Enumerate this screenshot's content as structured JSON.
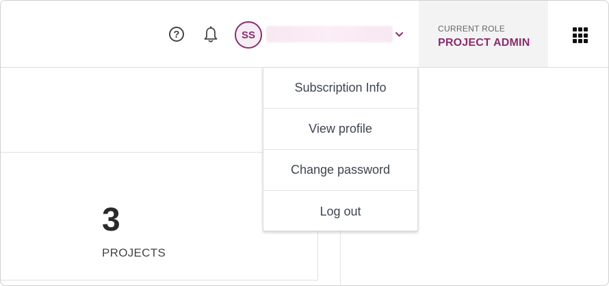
{
  "header": {
    "help_glyph": "?",
    "avatar_initials": "SS",
    "role_label": "CURRENT ROLE",
    "role_value": "PROJECT ADMIN",
    "icons": [
      "help-icon",
      "bell-icon",
      "chevron-down-icon",
      "apps-grid-icon"
    ],
    "accent_color": "#8a2b6f"
  },
  "user_menu": {
    "items": [
      {
        "label": "Subscription Info"
      },
      {
        "label": "View profile"
      },
      {
        "label": "Change password"
      },
      {
        "label": "Log out"
      }
    ]
  },
  "stats": {
    "projects_count": "3",
    "projects_label": "PROJECTS"
  }
}
